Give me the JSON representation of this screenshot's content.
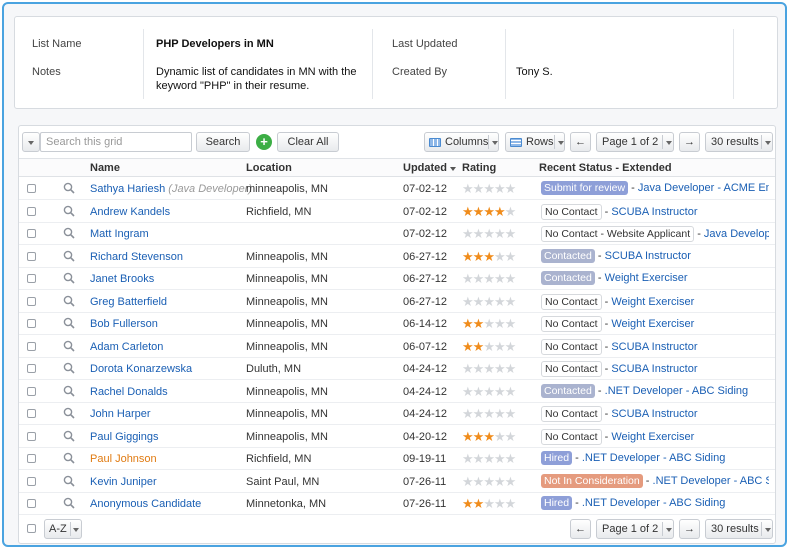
{
  "info": {
    "list_name_label": "List Name",
    "list_name": "PHP Developers in MN",
    "notes_label": "Notes",
    "notes_line1": "Dynamic list of candidates in MN with the",
    "notes_line2": "keyword \"PHP\" in their resume.",
    "last_updated_label": "Last Updated",
    "created_by_label": "Created By",
    "created_by": "Tony S."
  },
  "toolbar": {
    "search_placeholder": "Search this grid",
    "search_button": "Search",
    "plus": "+",
    "clear_all": "Clear All",
    "columns": "Columns",
    "rows": "Rows",
    "prev": "←",
    "next": "→",
    "page": "Page 1 of 2",
    "results": "30 results"
  },
  "columns": {
    "name": "Name",
    "location": "Location",
    "updated": "Updated",
    "rating": "Rating",
    "status": "Recent Status - Extended"
  },
  "rows": [
    {
      "name": "Sathya Hariesh",
      "sub": "(Java Developer)",
      "location": "minneapolis, MN",
      "updated": "07-02-12",
      "rating": 0,
      "badge": "Submit for review",
      "badge_style": "purple",
      "status_text": "Java Developer - ACME Enterprises"
    },
    {
      "name": "Andrew Kandels",
      "location": "Richfield, MN",
      "updated": "07-02-12",
      "rating": 4,
      "badge": "No Contact",
      "badge_style": "grey",
      "status_text": "SCUBA Instructor"
    },
    {
      "name": "Matt Ingram",
      "location": "",
      "updated": "07-02-12",
      "rating": 0,
      "badge": "No Contact - Website Applicant",
      "badge_style": "grey",
      "status_text": "Java Developer - A"
    },
    {
      "name": "Richard Stevenson",
      "location": "Minneapolis, MN",
      "updated": "06-27-12",
      "rating": 3,
      "badge": "Contacted",
      "badge_style": "contacted",
      "status_text": "SCUBA Instructor"
    },
    {
      "name": "Janet Brooks",
      "location": "Minneapolis, MN",
      "updated": "06-27-12",
      "rating": 0,
      "badge": "Contacted",
      "badge_style": "contacted",
      "status_text": "Weight Exerciser"
    },
    {
      "name": "Greg Batterfield",
      "location": "Minneapolis, MN",
      "updated": "06-27-12",
      "rating": 0,
      "badge": "No Contact",
      "badge_style": "grey",
      "status_text": "Weight Exerciser"
    },
    {
      "name": "Bob Fullerson",
      "location": "Minneapolis, MN",
      "updated": "06-14-12",
      "rating": 2,
      "badge": "No Contact",
      "badge_style": "grey",
      "status_text": "Weight Exerciser"
    },
    {
      "name": "Adam Carleton",
      "location": "Minneapolis, MN",
      "updated": "06-07-12",
      "rating": 2,
      "badge": "No Contact",
      "badge_style": "grey",
      "status_text": "SCUBA Instructor"
    },
    {
      "name": "Dorota Konarzewska",
      "location": "Duluth, MN",
      "updated": "04-24-12",
      "rating": 0,
      "badge": "No Contact",
      "badge_style": "grey",
      "status_text": "SCUBA Instructor"
    },
    {
      "name": "Rachel Donalds",
      "location": "Minneapolis, MN",
      "updated": "04-24-12",
      "rating": 0,
      "badge": "Contacted",
      "badge_style": "contacted",
      "status_text": ".NET Developer - ABC Siding"
    },
    {
      "name": "John Harper",
      "location": "Minneapolis, MN",
      "updated": "04-24-12",
      "rating": 0,
      "badge": "No Contact",
      "badge_style": "grey",
      "status_text": "SCUBA Instructor"
    },
    {
      "name": "Paul Giggings",
      "location": "Minneapolis, MN",
      "updated": "04-20-12",
      "rating": 3,
      "badge": "No Contact",
      "badge_style": "grey",
      "status_text": "Weight Exerciser"
    },
    {
      "name": "Paul Johnson",
      "location": "Richfield, MN",
      "updated": "09-19-11",
      "rating": 0,
      "badge": "Hired",
      "badge_style": "hired",
      "status_text": ".NET Developer - ABC Siding",
      "orange": true
    },
    {
      "name": "Kevin Juniper",
      "location": "Saint Paul, MN",
      "updated": "07-26-11",
      "rating": 0,
      "badge": "Not In Consideration",
      "badge_style": "notin",
      "status_text": ".NET Developer - ABC Siding"
    },
    {
      "name": "Anonymous Candidate",
      "location": "Minnetonka, MN",
      "updated": "07-26-11",
      "rating": 2,
      "badge": "Hired",
      "badge_style": "hired",
      "status_text": ".NET Developer - ABC Siding"
    }
  ],
  "footer": {
    "sort": "A-Z",
    "prev": "←",
    "next": "→",
    "page": "Page 1 of 2",
    "results": "30 results"
  },
  "colors": {
    "frame_border": "#4aa3e0",
    "link": "#1a5fb4",
    "star_on": "#f08c1b",
    "star_off": "#d3d6da"
  }
}
